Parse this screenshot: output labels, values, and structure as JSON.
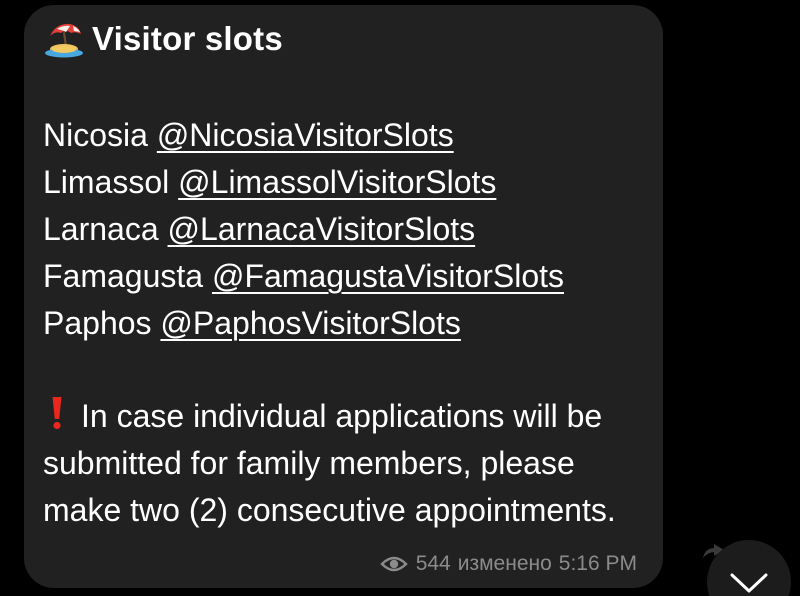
{
  "message": {
    "title": "Visitor slots",
    "title_icon": "desert-island-icon",
    "channels": [
      {
        "city": "Nicosia",
        "handle": "@NicosiaVisitorSlots"
      },
      {
        "city": "Limassol",
        "handle": "@LimassolVisitorSlots"
      },
      {
        "city": "Larnaca",
        "handle": "@LarnacaVisitorSlots"
      },
      {
        "city": "Famagusta",
        "handle": "@FamagustaVisitorSlots"
      },
      {
        "city": "Paphos",
        "handle": "@PaphosVisitorSlots"
      }
    ],
    "note": {
      "icon": "red-exclamation-icon",
      "text": "In case individual applications will be submitted for family members, please make two (2) consecutive appointments."
    },
    "views": "544",
    "edited_label": "изменено",
    "time": "5:16 PM"
  },
  "controls": {
    "scroll_down_icon": "chevron-down-icon"
  },
  "colors": {
    "background": "#000000",
    "bubble": "#212121",
    "text": "#ffffff",
    "meta": "#8b8b8b",
    "exclamation": "#e8271e"
  }
}
